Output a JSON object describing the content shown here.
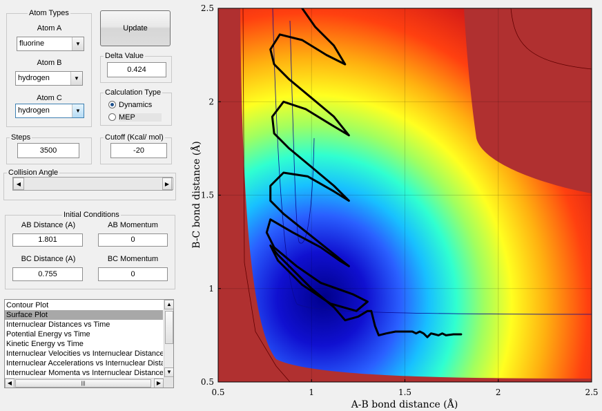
{
  "atom_types": {
    "legend": "Atom Types",
    "atom_a": {
      "label": "Atom A",
      "value": "fluorine"
    },
    "atom_b": {
      "label": "Atom B",
      "value": "hydrogen"
    },
    "atom_c": {
      "label": "Atom C",
      "value": "hydrogen"
    }
  },
  "update_button": "Update",
  "delta": {
    "legend": "Delta Value",
    "value": "0.424"
  },
  "calc_type": {
    "legend": "Calculation Type",
    "options": [
      "Dynamics",
      "MEP"
    ],
    "selected": "Dynamics"
  },
  "steps": {
    "legend": "Steps",
    "value": "3500"
  },
  "cutoff": {
    "legend": "Cutoff (Kcal/ mol)",
    "value": "-20"
  },
  "collision": {
    "legend": "Collision Angle",
    "slider_fraction": 0.0
  },
  "initial": {
    "legend": "Initial Conditions",
    "ab_distance": {
      "label": "AB Distance (A)",
      "value": "1.801"
    },
    "ab_momentum": {
      "label": "AB Momentum",
      "value": "0"
    },
    "bc_distance": {
      "label": "BC Distance (A)",
      "value": "0.755"
    },
    "bc_momentum": {
      "label": "BC Momentum",
      "value": "0"
    }
  },
  "plot_list": {
    "items": [
      "Contour Plot",
      "Surface Plot",
      "Internuclear Distances vs Time",
      "Potential Energy vs Time",
      "Kinetic Energy vs Time",
      "Internuclear Velocities vs Internuclear Distance",
      "Internuclear Accelerations vs Internuclear Distance",
      "Internuclear Momenta vs Internuclear Distance"
    ],
    "selected": "Surface Plot"
  },
  "chart_data": {
    "type": "heatmap",
    "xlabel": "A-B bond distance (Å)",
    "ylabel": "B-C bond distance (Å)",
    "xlim": [
      0.5,
      2.5
    ],
    "ylim": [
      0.5,
      2.5
    ],
    "xticks": [
      "0.5",
      "1",
      "1.5",
      "2",
      "2.5"
    ],
    "yticks": [
      "0.5",
      "1",
      "1.5",
      "2",
      "2.5"
    ],
    "colormap": "jet",
    "trajectory": {
      "color": "#000000",
      "start": [
        1.801,
        0.755
      ],
      "points": [
        [
          1.801,
          0.755
        ],
        [
          1.76,
          0.755
        ],
        [
          1.72,
          0.75
        ],
        [
          1.7,
          0.76
        ],
        [
          1.68,
          0.75
        ],
        [
          1.66,
          0.755
        ],
        [
          1.64,
          0.76
        ],
        [
          1.62,
          0.74
        ],
        [
          1.6,
          0.76
        ],
        [
          1.58,
          0.77
        ],
        [
          1.56,
          0.76
        ],
        [
          1.54,
          0.77
        ],
        [
          1.5,
          0.77
        ],
        [
          1.45,
          0.77
        ],
        [
          1.4,
          0.76
        ],
        [
          1.36,
          0.75
        ],
        [
          1.34,
          0.8
        ],
        [
          1.32,
          0.88
        ],
        [
          1.3,
          0.88
        ],
        [
          1.25,
          0.85
        ],
        [
          1.18,
          0.83
        ],
        [
          1.12,
          0.9
        ],
        [
          1.0,
          1.0
        ],
        [
          0.9,
          1.1
        ],
        [
          0.82,
          1.18
        ],
        [
          0.78,
          1.23
        ],
        [
          0.82,
          1.15
        ],
        [
          0.95,
          1.02
        ],
        [
          1.1,
          0.92
        ],
        [
          1.24,
          0.88
        ],
        [
          1.3,
          0.93
        ],
        [
          1.22,
          0.97
        ],
        [
          1.05,
          1.03
        ],
        [
          0.92,
          1.12
        ],
        [
          0.8,
          1.22
        ],
        [
          0.76,
          1.3
        ],
        [
          0.78,
          1.37
        ],
        [
          0.9,
          1.3
        ],
        [
          1.05,
          1.22
        ],
        [
          1.15,
          1.15
        ],
        [
          1.2,
          1.12
        ],
        [
          1.1,
          1.2
        ],
        [
          0.95,
          1.32
        ],
        [
          0.85,
          1.4
        ],
        [
          0.78,
          1.47
        ],
        [
          0.78,
          1.55
        ],
        [
          0.85,
          1.62
        ],
        [
          0.98,
          1.6
        ],
        [
          1.12,
          1.52
        ],
        [
          1.2,
          1.47
        ],
        [
          1.12,
          1.55
        ],
        [
          1.0,
          1.65
        ],
        [
          0.88,
          1.75
        ],
        [
          0.8,
          1.83
        ],
        [
          0.79,
          1.92
        ],
        [
          0.85,
          2.0
        ],
        [
          0.97,
          1.96
        ],
        [
          1.1,
          1.88
        ],
        [
          1.2,
          1.82
        ],
        [
          1.12,
          1.92
        ],
        [
          1.0,
          2.02
        ],
        [
          0.88,
          2.12
        ],
        [
          0.8,
          2.2
        ],
        [
          0.78,
          2.28
        ],
        [
          0.83,
          2.36
        ],
        [
          0.95,
          2.33
        ],
        [
          1.08,
          2.25
        ],
        [
          1.18,
          2.2
        ],
        [
          1.12,
          2.3
        ],
        [
          1.02,
          2.4
        ],
        [
          0.95,
          2.5
        ]
      ]
    }
  }
}
